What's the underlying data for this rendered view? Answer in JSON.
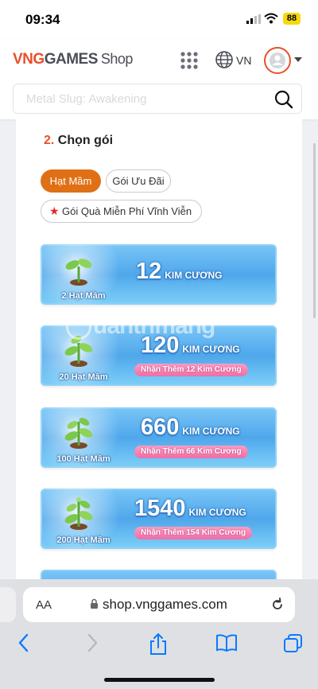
{
  "status": {
    "time": "09:34",
    "battery": "88"
  },
  "header": {
    "logo_vng": "VNG",
    "logo_games": "GAMES",
    "logo_shop": "Shop",
    "language": "VN",
    "search_placeholder": "Metal Slug: Awakening"
  },
  "section": {
    "step_number": "2.",
    "step_title": "Chọn gói",
    "tabs": [
      {
        "label": "Hạt Mầm",
        "active": true
      },
      {
        "label": "Gói Ưu Đãi",
        "active": false
      },
      {
        "label": "Gói Quà Miễn Phí Vĩnh Viễn",
        "active": false
      }
    ]
  },
  "packages": [
    {
      "seeds": "2 Hạt Mầm",
      "amount": "12",
      "unit": "KIM CƯƠNG",
      "bonus": ""
    },
    {
      "seeds": "20 Hạt Mầm",
      "amount": "120",
      "unit": "KIM CƯƠNG",
      "bonus": "Nhận Thêm 12 Kim Cương"
    },
    {
      "seeds": "100 Hạt Mầm",
      "amount": "660",
      "unit": "KIM CƯƠNG",
      "bonus": "Nhận Thêm 66 Kim Cương"
    },
    {
      "seeds": "200 Hạt Mầm",
      "amount": "1540",
      "unit": "KIM CƯƠNG",
      "bonus": "Nhận Thêm 154 Kim Cương"
    }
  ],
  "watermark": "uantrimang",
  "browser": {
    "aa_label": "AA",
    "url": "shop.vnggames.com"
  },
  "colors": {
    "accent": "#e8502a",
    "active_tab": "#e07016",
    "link_blue": "#0a7aff"
  }
}
